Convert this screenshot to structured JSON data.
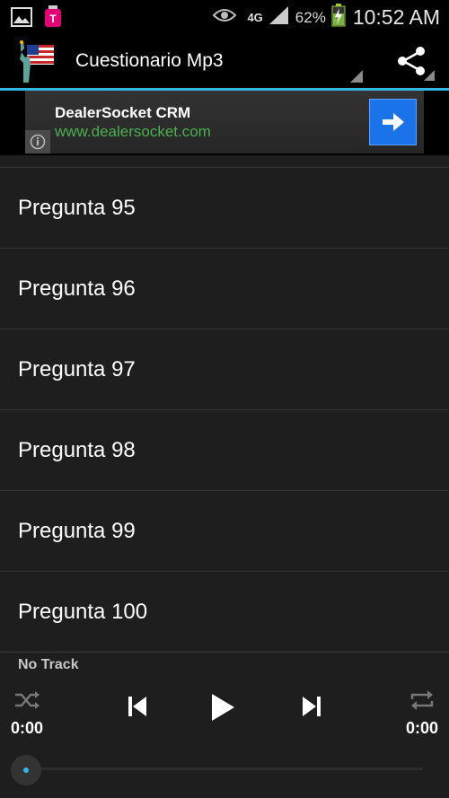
{
  "status_bar": {
    "battery_pct": "62%",
    "time": "10:52 AM",
    "network": "4G",
    "icons": [
      "gallery-icon",
      "tmobile-icon",
      "eye-icon",
      "signal-icon",
      "battery-charging-icon"
    ]
  },
  "action_bar": {
    "title": "Cuestionario Mp3",
    "icons": [
      "statue-of-liberty-flag-icon",
      "share-icon"
    ]
  },
  "ad": {
    "title": "DealerSocket CRM",
    "url": "www.dealersocket.com",
    "icons": [
      "info-icon",
      "arrow-right-icon"
    ]
  },
  "list": {
    "items": [
      {
        "label": "Pregunta 95"
      },
      {
        "label": "Pregunta 96"
      },
      {
        "label": "Pregunta 97"
      },
      {
        "label": "Pregunta 98"
      },
      {
        "label": "Pregunta 99"
      },
      {
        "label": "Pregunta 100"
      }
    ]
  },
  "player": {
    "track": "No Track",
    "elapsed": "0:00",
    "duration": "0:00",
    "progress": 0,
    "icons": [
      "shuffle-icon",
      "previous-icon",
      "play-icon",
      "next-icon",
      "repeat-icon"
    ]
  },
  "colors": {
    "accent": "#33b5e5",
    "list_bg": "#1e1e1e",
    "ad_url": "#4caf50",
    "ad_button": "#1a73e8"
  }
}
